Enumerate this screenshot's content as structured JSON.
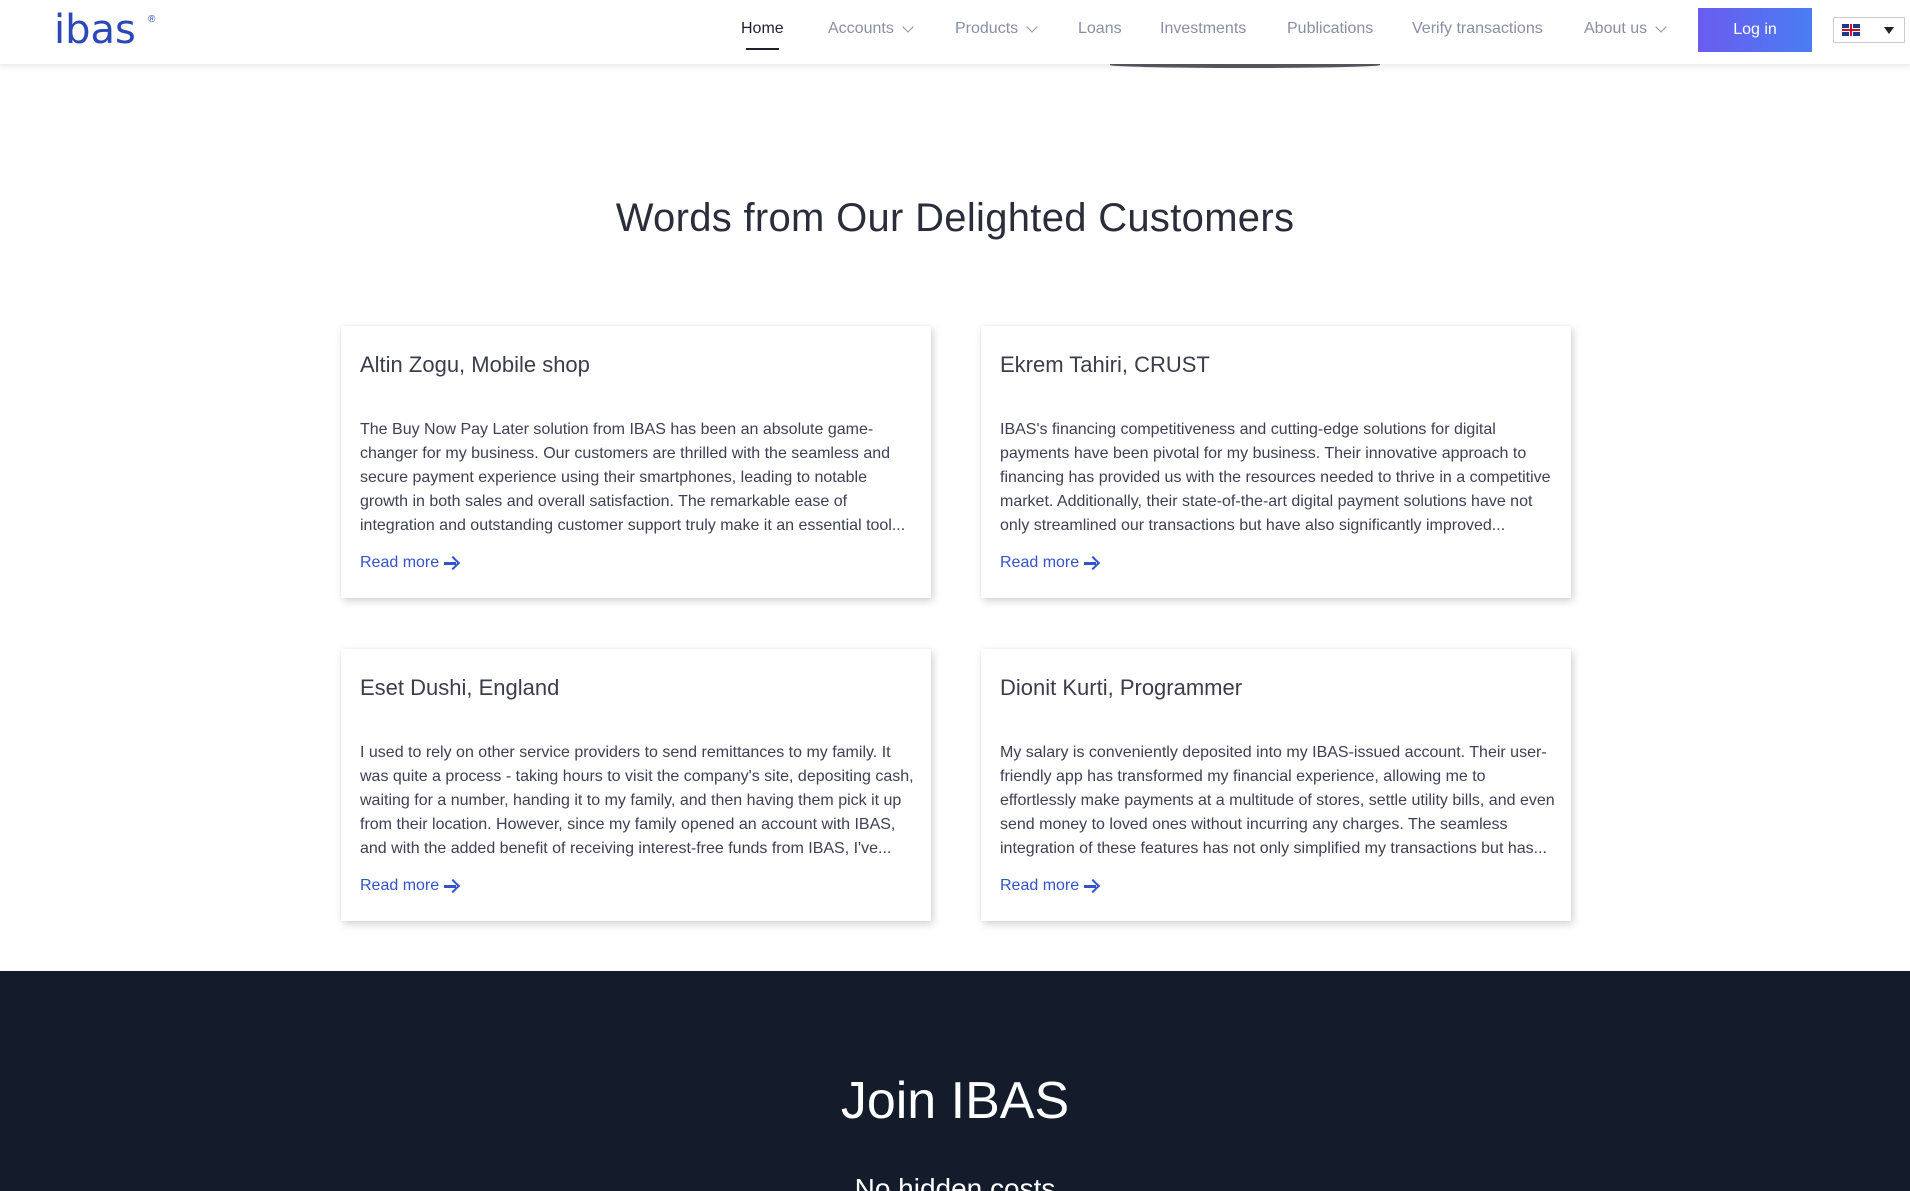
{
  "header": {
    "logo": "ibas",
    "logo_mark": "®",
    "nav": [
      {
        "label": "Home"
      },
      {
        "label": "Accounts"
      },
      {
        "label": "Products"
      },
      {
        "label": "Loans"
      },
      {
        "label": "Investments"
      },
      {
        "label": "Publications"
      },
      {
        "label": "Verify transactions"
      },
      {
        "label": "About us"
      }
    ],
    "active_nav": "Home",
    "login_label": "Log in",
    "language_icon": "uk-flag-icon"
  },
  "testimonials": {
    "title": "Words from Our Delighted Customers",
    "read_more_label": "Read more",
    "items": [
      {
        "name": "Altin Zogu, Mobile shop",
        "text": "The Buy Now Pay Later solution from IBAS has been an absolute game-changer for my business. Our customers are thrilled with the seamless and secure payment experience using their smartphones, leading to notable growth in both sales and overall satisfaction. The remarkable ease of integration and outstanding customer support truly make it an essential tool..."
      },
      {
        "name": "Ekrem Tahiri, CRUST",
        "text": "IBAS's financing competitiveness and cutting-edge solutions for digital payments have been pivotal for my business. Their innovative approach to financing has provided us with the resources needed to thrive in a competitive market. Additionally, their state-of-the-art digital payment solutions have not only streamlined our transactions but have also significantly improved..."
      },
      {
        "name": "Eset Dushi, England",
        "text": "I used to rely on other service providers to send remittances to my family. It was quite a process - taking hours to visit the company's site, depositing cash, waiting for a number, handing it to my family, and then having them pick it up from their location. However, since my family opened an account with IBAS, and with the added benefit of receiving interest-free funds from IBAS, I've..."
      },
      {
        "name": "Dionit Kurti, Programmer",
        "text": "My salary is conveniently deposited into my IBAS-issued account. Their user-friendly app has transformed my financial experience, allowing me to effortlessly make payments at a multitude of stores, settle utility bills, and even send money to loved ones without incurring any charges. The seamless integration of these features has not only simplified my transactions but has..."
      }
    ]
  },
  "join": {
    "title": "Join IBAS",
    "subtitle": "No hidden costs"
  }
}
